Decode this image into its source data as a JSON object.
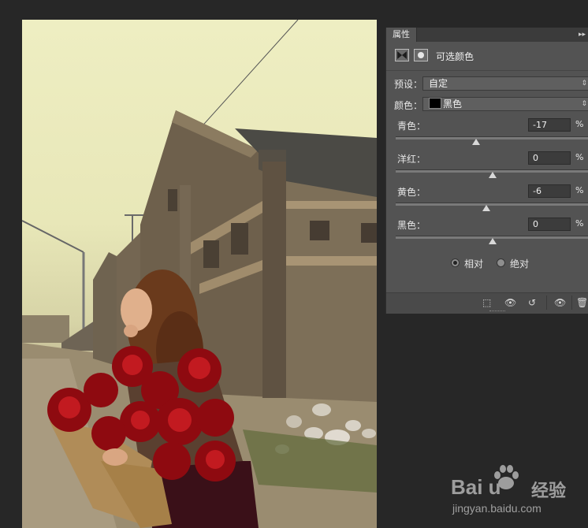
{
  "panel": {
    "tab_label": "属性",
    "menu_glyph": "▸▸",
    "adjustment_title": "可选颜色",
    "preset_label": "预设：",
    "preset_value": "自定",
    "colors_label": "颜色：",
    "colors_value": "黑色",
    "dropdown_arrow": "⇕",
    "sliders": [
      {
        "label": "青色：",
        "value": "-17",
        "unit": "%",
        "amount": -17
      },
      {
        "label": "洋红：",
        "value": "0",
        "unit": "%",
        "amount": 0
      },
      {
        "label": "黄色：",
        "value": "-6",
        "unit": "%",
        "amount": -6
      },
      {
        "label": "黑色：",
        "value": "0",
        "unit": "%",
        "amount": 0
      }
    ],
    "method_relative": "相对",
    "method_absolute": "绝对",
    "method_selected": "relative",
    "footer_icons": {
      "clip": "⬚",
      "view_previous": "👁",
      "reset": "↺",
      "visibility": "👁",
      "delete": "🗑"
    }
  },
  "watermark": {
    "brand": "Bai  u",
    "brand_cn": "经验",
    "url": "jingyan.baidu.com"
  },
  "colors": {
    "panel_bg": "#535353",
    "workspace_bg": "#272727",
    "swatch_black": "#000000"
  }
}
